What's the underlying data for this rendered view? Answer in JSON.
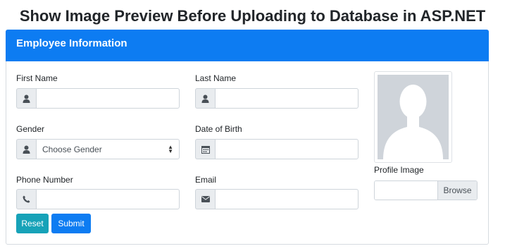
{
  "page": {
    "title": "Show Image Preview Before Uploading to Database in ASP.NET"
  },
  "card": {
    "header": "Employee Information"
  },
  "form": {
    "first_name": {
      "label": "First Name",
      "value": "",
      "icon": "user-icon"
    },
    "last_name": {
      "label": "Last Name",
      "value": "",
      "icon": "user-icon"
    },
    "gender": {
      "label": "Gender",
      "selected": "Choose Gender",
      "icon": "user-icon"
    },
    "dob": {
      "label": "Date of Birth",
      "value": "",
      "icon": "calendar-icon"
    },
    "phone": {
      "label": "Phone Number",
      "value": "",
      "icon": "phone-icon"
    },
    "email": {
      "label": "Email",
      "value": "",
      "icon": "envelope-icon"
    }
  },
  "profile": {
    "label": "Profile Image",
    "browse": "Browse"
  },
  "buttons": {
    "reset": "Reset",
    "submit": "Submit"
  },
  "colors": {
    "primary": "#0d7cf2",
    "info": "#17a2b8",
    "addon": "#e9ecef",
    "placeholder_avatar": "#cfd4da"
  }
}
